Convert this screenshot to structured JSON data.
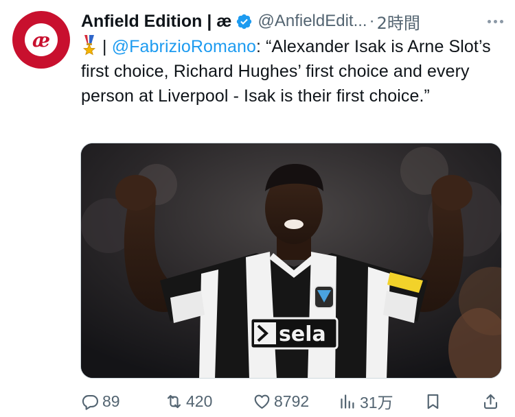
{
  "tweet": {
    "author": {
      "display_name": "Anfield Edition | æ",
      "handle": "@AnfieldEdit...",
      "avatar_text": "æ",
      "verified": true
    },
    "separator": "·",
    "time": "2時間",
    "text": {
      "medal_icon": "military-medal-emoji",
      "pipe": " | ",
      "mention": "@FabrizioRomano",
      "body": ": “Alexander Isak is Arne Slot’s first choice, Richard Hughes’ first choice and every person at Liverpool - Isak is their first choice.”"
    },
    "media": {
      "jersey_sponsor": "sela"
    },
    "actions": {
      "replies": "89",
      "retweets": "420",
      "likes": "8792",
      "views": "31万"
    }
  },
  "colors": {
    "accent": "#1d9bf0",
    "brand_red": "#c8102e",
    "muted": "#536471"
  }
}
